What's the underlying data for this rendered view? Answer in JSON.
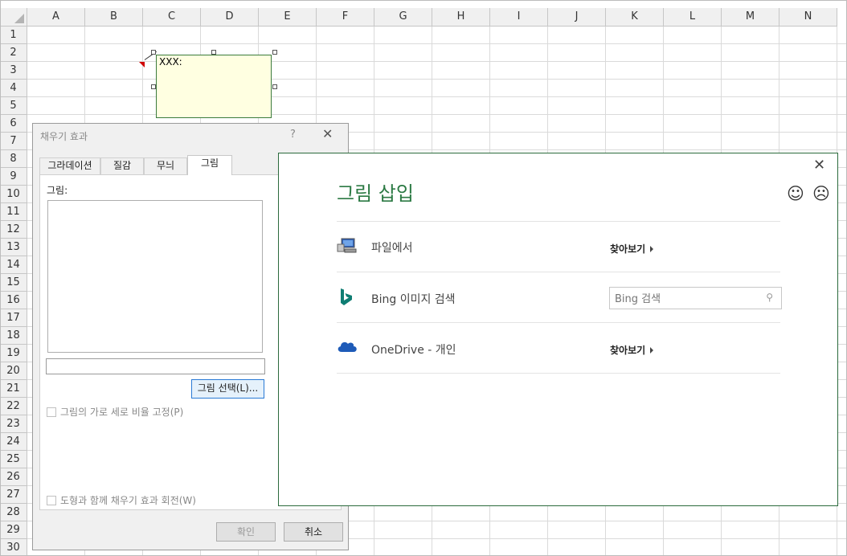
{
  "sheet": {
    "columns": [
      "A",
      "B",
      "C",
      "D",
      "E",
      "F",
      "G",
      "H",
      "I",
      "J",
      "K",
      "L",
      "M",
      "N"
    ],
    "rows": [
      "1",
      "2",
      "3",
      "4",
      "5",
      "6",
      "7",
      "8",
      "9",
      "10",
      "11",
      "12",
      "13",
      "14",
      "15",
      "16",
      "17",
      "18",
      "19",
      "20",
      "21",
      "22",
      "23",
      "24",
      "25",
      "26",
      "27",
      "28",
      "29",
      "30"
    ]
  },
  "comment": {
    "text": "XXX:"
  },
  "fill_dialog": {
    "title": "채우기 효과",
    "help": "?",
    "tabs": [
      {
        "label": "그라데이션"
      },
      {
        "label": "질감"
      },
      {
        "label": "무늬"
      },
      {
        "label": "그림"
      }
    ],
    "active_tab": "그림",
    "picture_label": "그림:",
    "select_button": "그림 선택(L)...",
    "lock_ratio": "그림의 가로 세로 비율 고정(P)",
    "rotate_with_shape": "도형과 함께 채우기 효과 회전(W)",
    "ok": "확인",
    "cancel": "취소"
  },
  "insert_picture": {
    "title": "그림 삽입",
    "sources": [
      {
        "label": "파일에서",
        "action": "찾아보기",
        "icon": "computer-icon"
      },
      {
        "label": "Bing 이미지 검색",
        "search_placeholder": "Bing 검색",
        "icon": "bing-icon"
      },
      {
        "label": "OneDrive - 개인",
        "action": "찾아보기",
        "icon": "onedrive-icon"
      }
    ]
  },
  "colors": {
    "accent_green": "#2c7a44",
    "comment_bg": "#ffffe1",
    "bing_teal": "#0f7d73",
    "onedrive_blue": "#1e5bb8"
  }
}
